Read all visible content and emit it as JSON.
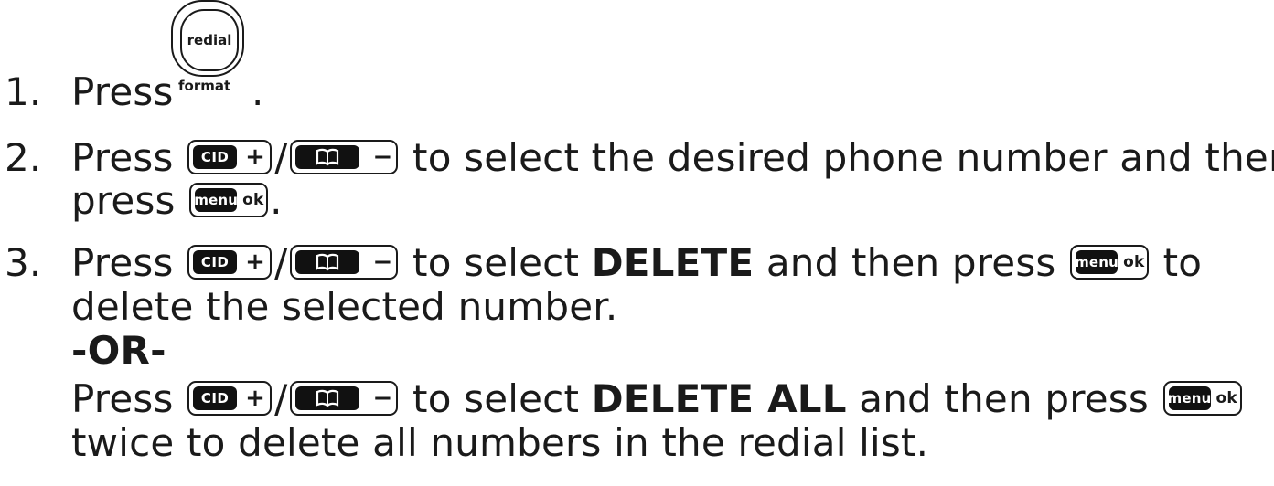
{
  "steps": {
    "s1": {
      "num": "1.",
      "text": "Press"
    },
    "s2": {
      "num": "2.",
      "pre": "Press",
      "post": "to select the desired phone number and then",
      "cont": "press"
    },
    "s3": {
      "num": "3.",
      "pre": "Press",
      "mid1": "to select",
      "delete": "DELETE",
      "mid2": "and then press",
      "end": "to",
      "cont": "delete the selected number."
    },
    "or": "-OR-",
    "alt": {
      "pre": "Press",
      "mid1": "to select",
      "delete_all": "DELETE ALL",
      "mid2": "and then press",
      "cont": "twice to delete all numbers in the redial list."
    }
  },
  "keys": {
    "redial": {
      "label": "redial",
      "sub": "format",
      "icon": "redial-key-icon"
    },
    "cid": {
      "label": "CID",
      "symbol": "+",
      "icon": "cid-key-icon"
    },
    "book": {
      "symbol": "−",
      "icon": "phonebook-key-icon"
    },
    "menu": {
      "label": "menu",
      "symbol": "ok",
      "icon": "menu-ok-key-icon"
    },
    "slash": "/",
    "period": "."
  }
}
